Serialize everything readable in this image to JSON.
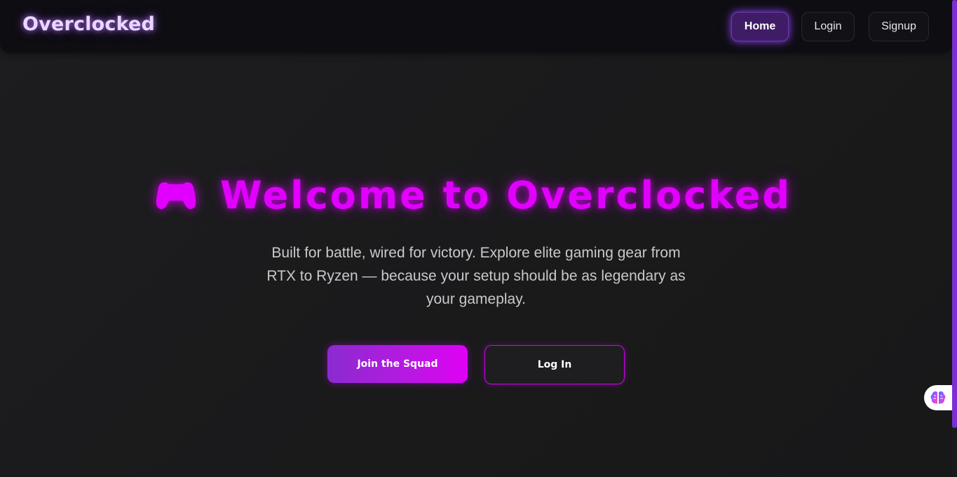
{
  "navbar": {
    "brand": "Overclocked",
    "items": [
      {
        "label": "Home",
        "active": true
      },
      {
        "label": "Login",
        "active": false
      },
      {
        "label": "Signup",
        "active": false
      }
    ]
  },
  "hero": {
    "icon": "gamepad-icon",
    "title": "Welcome to Overclocked",
    "subtitle": "Built for battle, wired for victory. Explore elite gaming gear from RTX to Ryzen — because your setup should be as legendary as your gameplay.",
    "primary_button": "Join the Squad",
    "secondary_button": "Log In"
  },
  "widget": {
    "icon": "brain-icon"
  },
  "colors": {
    "accent": "#e100ff",
    "accent_purple": "#8a2bd0",
    "background": "#1a1a1c",
    "navbar": "#0e0d12",
    "brand_glow": "#be78ff"
  }
}
